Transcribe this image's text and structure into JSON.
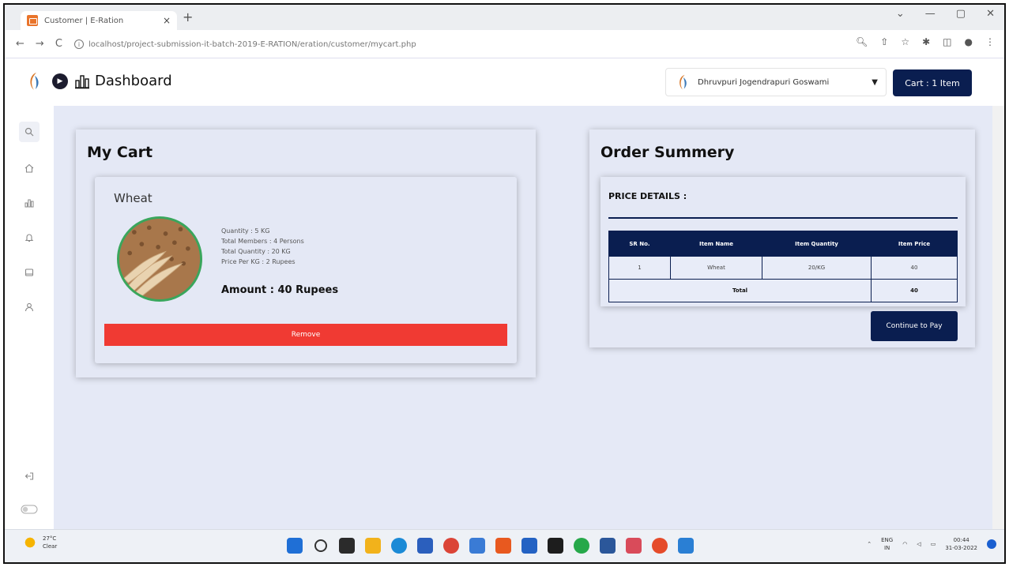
{
  "browser": {
    "tab_title": "Customer | E-Ration",
    "tab_close": "×",
    "new_tab": "+",
    "url": "localhost/project-submission-it-batch-2019-E-RATION/eration/customer/mycart.php",
    "window_controls": [
      "⌄",
      "—",
      "▢",
      "✕"
    ]
  },
  "header": {
    "title": "Dashboard",
    "user_name": "Dhruvpuri Jogendrapuri Goswami",
    "cart_label": "Cart : 1 Item"
  },
  "cart": {
    "title": "My Cart",
    "item": {
      "name": "Wheat",
      "quantity": "Quantity : 5 KG",
      "members": "Total Members : 4 Persons",
      "total_quantity": "Total Quantity : 20 KG",
      "price_per_kg": "Price Per KG : 2 Rupees",
      "amount": "Amount : 40 Rupees"
    },
    "remove_label": "Remove"
  },
  "summary": {
    "title": "Order Summery",
    "price_heading": "PRICE DETAILS :",
    "columns": [
      "SR No.",
      "Item Name",
      "Item Quantity",
      "Item Price"
    ],
    "rows": [
      {
        "sr": "1",
        "name": "Wheat",
        "quantity": "20/KG",
        "price": "40"
      }
    ],
    "total_label": "Total",
    "total_value": "40",
    "pay_label": "Continue to Pay"
  },
  "taskbar": {
    "temp": "27°C",
    "condition": "Clear",
    "lang_top": "ENG",
    "lang_bottom": "IN",
    "time": "00:44",
    "date": "31-03-2022"
  },
  "colors": {
    "navy": "#0a1e50",
    "remove": "#f03a33",
    "content_bg": "#e5e9f6"
  }
}
